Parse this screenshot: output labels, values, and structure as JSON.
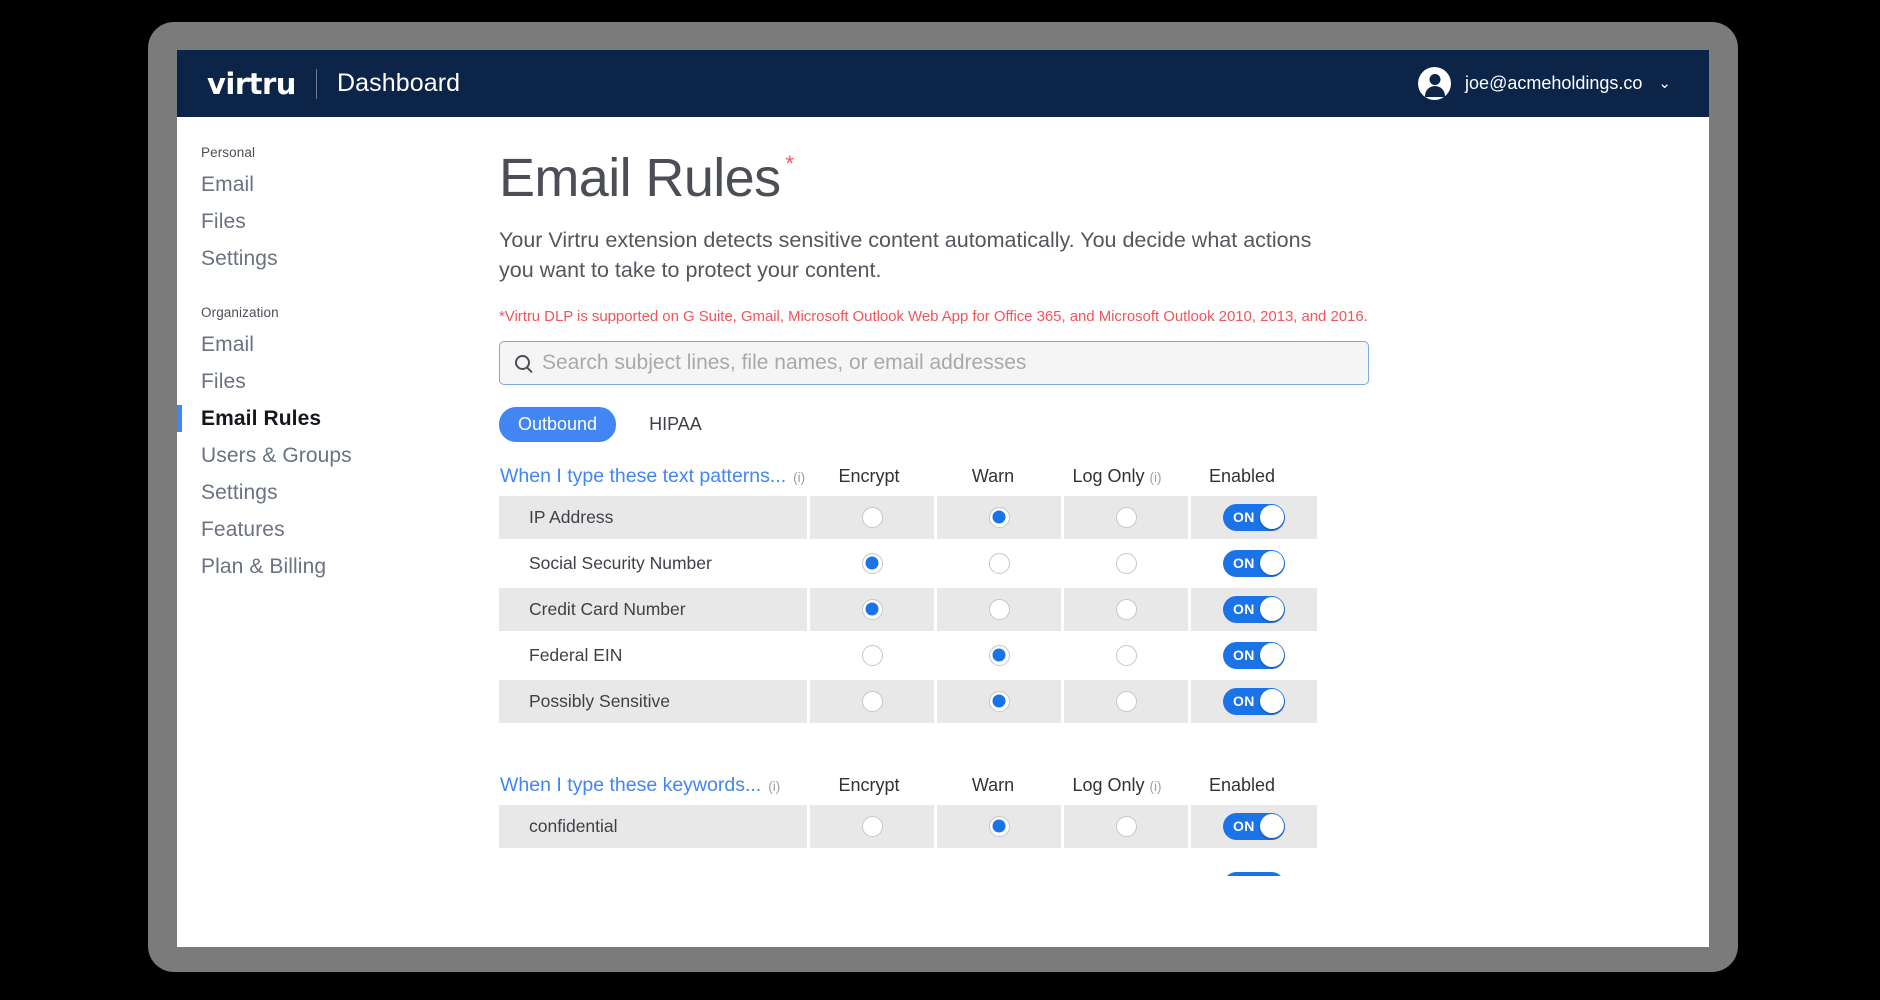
{
  "topbar": {
    "brand": "virtru",
    "page": "Dashboard",
    "user_email": "joe@acmeholdings.co",
    "chevron": "⌄",
    "avatar_icon": "user-avatar-icon"
  },
  "sidebar": {
    "groups": [
      {
        "heading": "Personal",
        "items": [
          {
            "label": "Email",
            "active": false
          },
          {
            "label": "Files",
            "active": false
          },
          {
            "label": "Settings",
            "active": false
          }
        ]
      },
      {
        "heading": "Organization",
        "items": [
          {
            "label": "Email",
            "active": false
          },
          {
            "label": "Files",
            "active": false
          },
          {
            "label": "Email Rules",
            "active": true
          },
          {
            "label": "Users & Groups",
            "active": false
          },
          {
            "label": "Settings",
            "active": false
          },
          {
            "label": "Features",
            "active": false
          },
          {
            "label": "Plan & Billing",
            "active": false
          }
        ]
      }
    ]
  },
  "main": {
    "title": "Email Rules",
    "title_asterisk": "*",
    "description": "Your Virtru extension detects sensitive content automatically. You decide what actions you want to take to protect your content.",
    "note": "*Virtru DLP is supported on G Suite, Gmail, Microsoft Outlook Web App for Office 365, and Microsoft Outlook 2010, 2013, and 2016.",
    "search": {
      "placeholder": "Search subject lines, file names, or email addresses",
      "value": "",
      "icon": "search-icon"
    },
    "tabs": [
      {
        "label": "Outbound",
        "active": true
      },
      {
        "label": "HIPAA",
        "active": false
      }
    ],
    "tables": [
      {
        "name_header": "When I type these text patterns...",
        "name_header_info": "(i)",
        "columns": [
          {
            "label": "Encrypt",
            "info": ""
          },
          {
            "label": "Warn",
            "info": ""
          },
          {
            "label": "Log Only",
            "info": "(i)"
          }
        ],
        "enabled_header": "Enabled",
        "rows": [
          {
            "name": "IP Address",
            "encrypt": false,
            "warn": true,
            "log_only": false,
            "enabled": "ON",
            "shaded": true
          },
          {
            "name": "Social Security Number",
            "encrypt": true,
            "warn": false,
            "log_only": false,
            "enabled": "ON",
            "shaded": false
          },
          {
            "name": "Credit Card Number",
            "encrypt": true,
            "warn": false,
            "log_only": false,
            "enabled": "ON",
            "shaded": true
          },
          {
            "name": "Federal EIN",
            "encrypt": false,
            "warn": true,
            "log_only": false,
            "enabled": "ON",
            "shaded": false
          },
          {
            "name": "Possibly Sensitive",
            "encrypt": false,
            "warn": true,
            "log_only": false,
            "enabled": "ON",
            "shaded": true
          }
        ]
      },
      {
        "name_header": "When I type these keywords...",
        "name_header_info": "(i)",
        "columns": [
          {
            "label": "Encrypt",
            "info": ""
          },
          {
            "label": "Warn",
            "info": ""
          },
          {
            "label": "Log Only",
            "info": "(i)"
          }
        ],
        "enabled_header": "Enabled",
        "rows": [
          {
            "name": "confidential",
            "encrypt": false,
            "warn": true,
            "log_only": false,
            "enabled": "ON",
            "shaded": true
          }
        ]
      }
    ]
  },
  "colors": {
    "nav_bg": "#0b2447",
    "accent_blue": "#4285f4",
    "radio_blue": "#1a73e8",
    "note_red": "#f2545b",
    "row_shade": "#e8e8e8",
    "frame_gray": "#7b7b7b"
  }
}
